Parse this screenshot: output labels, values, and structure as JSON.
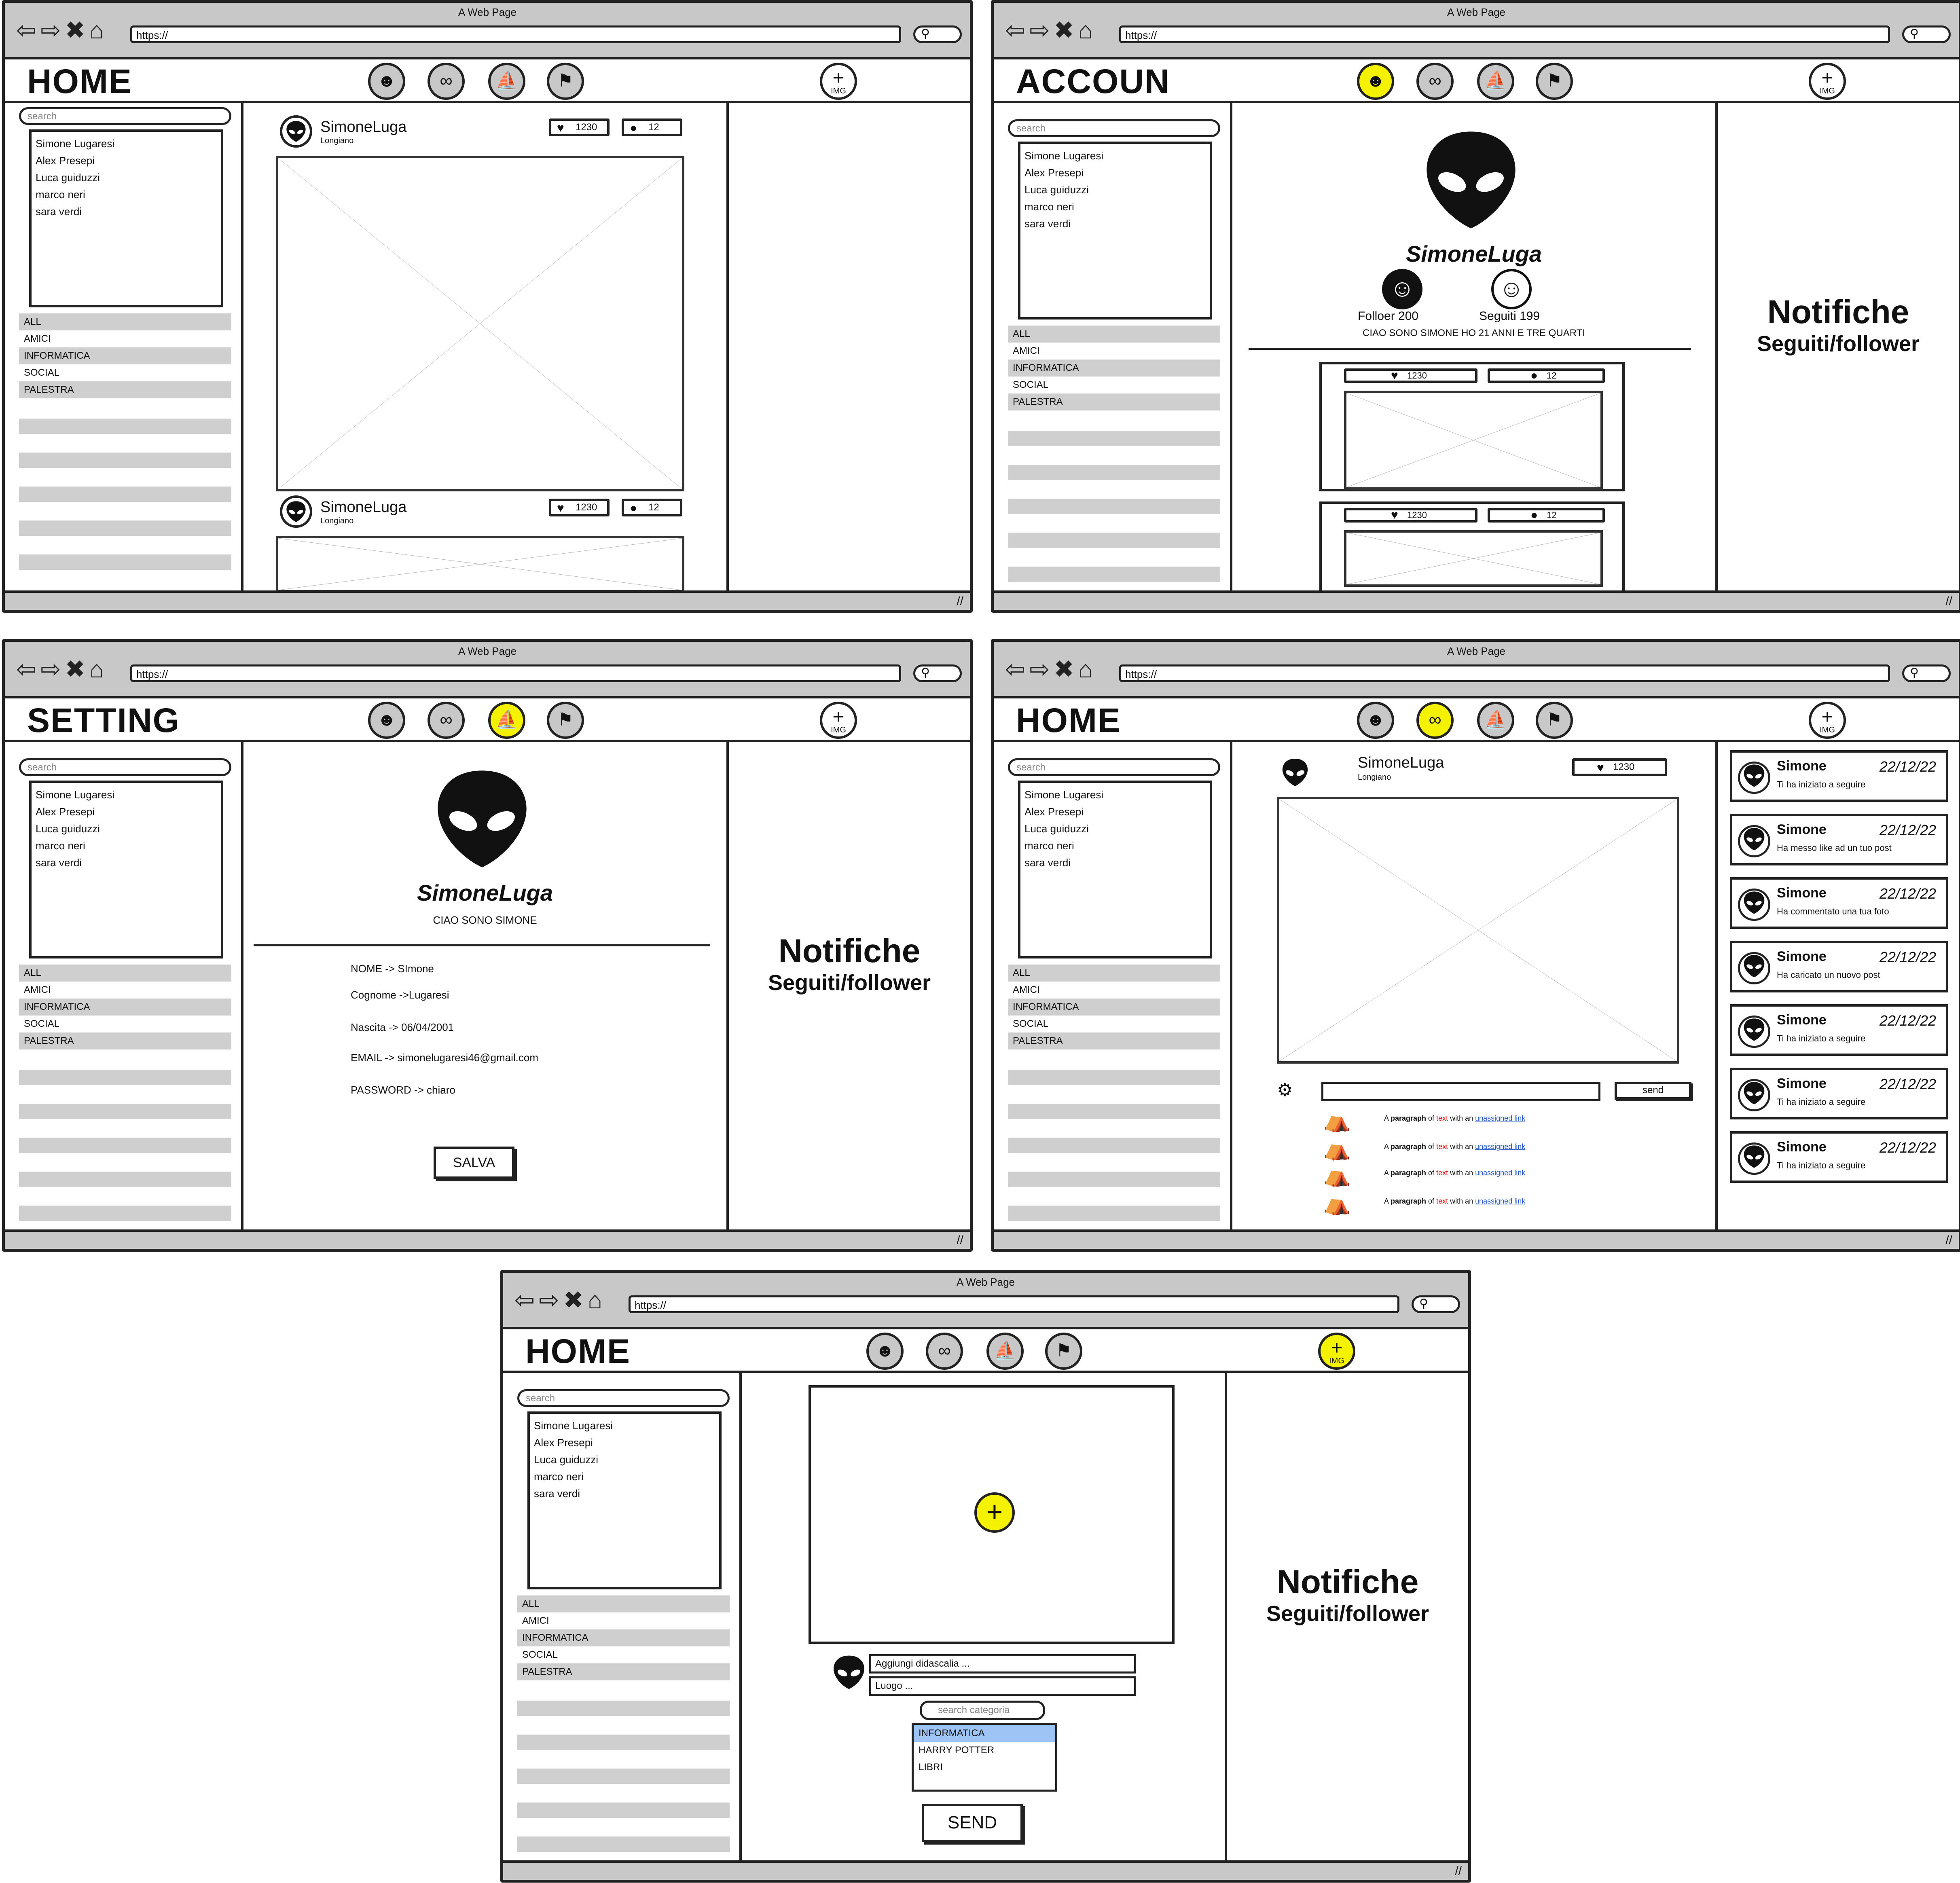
{
  "browser": {
    "title": "A Web Page",
    "url": "https://"
  },
  "users": [
    "Simone Lugaresi",
    "Alex Presepi",
    "Luca guiduzzi",
    "marco neri",
    "sara verdi"
  ],
  "categories": [
    "ALL",
    "AMICI",
    "INFORMATICA",
    "SOCIAL",
    "PALESTRA"
  ],
  "search_placeholder": "search",
  "nav_img_label": "IMG",
  "screens": {
    "home": {
      "title": "HOME",
      "post1": {
        "user": "SimoneLuga",
        "place": "Longiano",
        "likes": "1230",
        "comments": "12"
      },
      "post2": {
        "user": "SimoneLuga",
        "place": "Longiano",
        "likes": "1230",
        "comments": "12"
      }
    },
    "account": {
      "title": "ACCOUN",
      "username": "SimoneLuga",
      "followers": "Folloer 200",
      "following": "Seguiti 199",
      "bio": "CIAO SONO SIMONE HO 21 ANNI E TRE QUARTI",
      "notif_title": "Notifiche",
      "notif_sub": "Seguiti/follower",
      "likes": "1230",
      "comments": "12"
    },
    "setting": {
      "title": "SETTING",
      "username": "SimoneLuga",
      "bio": "CIAO SONO SIMONE",
      "fields": [
        "NOME -> SImone",
        "Cognome ->Lugaresi",
        "Nascita -> 06/04/2001",
        "EMAIL -> simonelugaresi46@gmail.com",
        "PASSWORD -> chiaro"
      ],
      "save": "SALVA",
      "notif_title": "Notifiche",
      "notif_sub": "Seguiti/follower"
    },
    "home2": {
      "title": "HOME",
      "user": "SimoneLuga",
      "place": "Longiano",
      "likes": "1230",
      "send": "send",
      "paragraph": {
        "a": "A ",
        "b": "paragraph",
        "c": " of ",
        "d": "text",
        "e": " with an ",
        "f": "unassigned link"
      },
      "notifications": [
        {
          "name": "Simone",
          "date": "22/12/22",
          "text": "Ti ha iniziato a seguire"
        },
        {
          "name": "Simone",
          "date": "22/12/22",
          "text": "Ha messo like ad un tuo post"
        },
        {
          "name": "Simone",
          "date": "22/12/22",
          "text": "Ha commentato una tua foto"
        },
        {
          "name": "Simone",
          "date": "22/12/22",
          "text": "Ha caricato un nuovo post"
        },
        {
          "name": "Simone",
          "date": "22/12/22",
          "text": "Ti ha iniziato a seguire"
        },
        {
          "name": "Simone",
          "date": "22/12/22",
          "text": "Ti ha iniziato a seguire"
        },
        {
          "name": "Simone",
          "date": "22/12/22",
          "text": "Ti ha iniziato a seguire"
        }
      ]
    },
    "upload": {
      "title": "HOME",
      "caption": "Aggiungi didascalia ...",
      "place": "Luogo ...",
      "cat_search": "search categoria",
      "cat_options": [
        "INFORMATICA",
        "HARRY POTTER",
        "LIBRI"
      ],
      "send": "SEND",
      "notif_title": "Notifiche",
      "notif_sub": "Seguiti/follower"
    }
  },
  "colors": {
    "accent": "#f5f200",
    "selected": "#9ec3f5",
    "panel": "#cfcfcf"
  }
}
